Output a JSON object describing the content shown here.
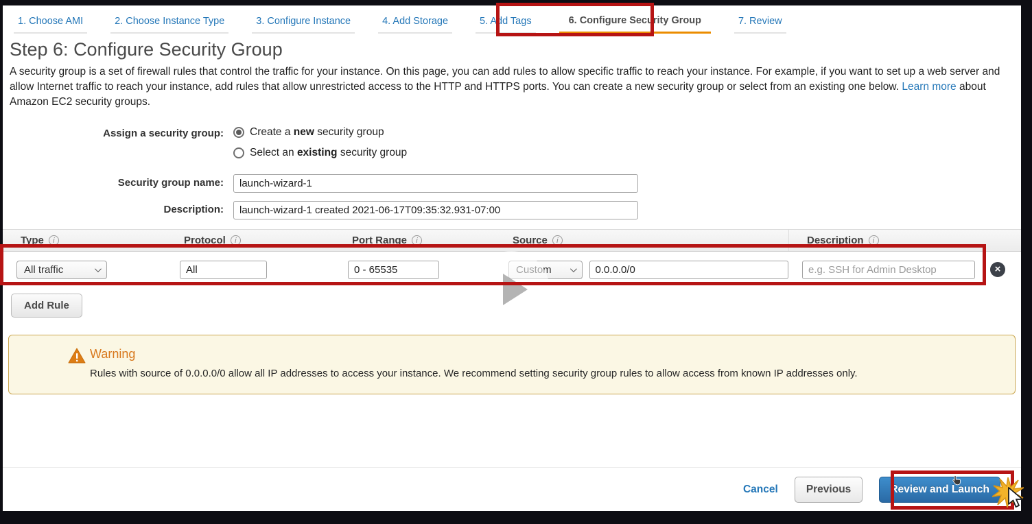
{
  "colors": {
    "link_blue": "#2477b8",
    "active_tab_underline": "#eb8c00",
    "annotation_red": "#b61414",
    "warning_orange": "#d8781d",
    "warning_background": "#fbf7e4",
    "primary_button_blue": "#2a6aa5"
  },
  "tabs": {
    "active_index": 5,
    "items": [
      {
        "label": "1. Choose AMI"
      },
      {
        "label": "2. Choose Instance Type"
      },
      {
        "label": "3. Configure Instance"
      },
      {
        "label": "4. Add Storage"
      },
      {
        "label": "5. Add Tags"
      },
      {
        "label": "6. Configure Security Group"
      },
      {
        "label": "7. Review"
      }
    ]
  },
  "header": {
    "title": "Step 6: Configure Security Group",
    "description": "A security group is a set of firewall rules that control the traffic for your instance. On this page, you can add rules to allow specific traffic to reach your instance. For example, if you want to set up a web server and allow Internet traffic to reach your instance, add rules that allow unrestricted access to the HTTP and HTTPS ports. You can create a new security group or select from an existing one below.",
    "learn_more_label": "Learn more",
    "learn_more_suffix": " about Amazon EC2 security groups."
  },
  "form": {
    "assign_label": "Assign a security group:",
    "radio_new": {
      "prefix": "Create a ",
      "bold": "new",
      "suffix": " security group",
      "selected": true
    },
    "radio_existing": {
      "prefix": "Select an ",
      "bold": "existing",
      "suffix": " security group",
      "selected": false
    },
    "name_label": "Security group name:",
    "name_value": "launch-wizard-1",
    "description_label": "Description:",
    "description_value": "launch-wizard-1 created 2021-06-17T09:35:32.931-07:00"
  },
  "rules_table": {
    "columns": [
      {
        "label": "Type"
      },
      {
        "label": "Protocol"
      },
      {
        "label": "Port Range"
      },
      {
        "label": "Source"
      },
      {
        "label": "Description"
      }
    ],
    "rows": [
      {
        "type": "All traffic",
        "protocol": "All",
        "port_range": "0 - 65535",
        "source_mode": "Custom",
        "source_value": "0.0.0.0/0",
        "description_placeholder": "e.g. SSH for Admin Desktop"
      }
    ],
    "add_rule_label": "Add Rule"
  },
  "warning": {
    "title": "Warning",
    "message": "Rules with source of 0.0.0.0/0 allow all IP addresses to access your instance. We recommend setting security group rules to allow access from known IP addresses only."
  },
  "footer": {
    "cancel_label": "Cancel",
    "previous_label": "Previous",
    "review_label": "Review and Launch"
  },
  "icons": {
    "info_icon": "i",
    "delete_icon": "×"
  }
}
